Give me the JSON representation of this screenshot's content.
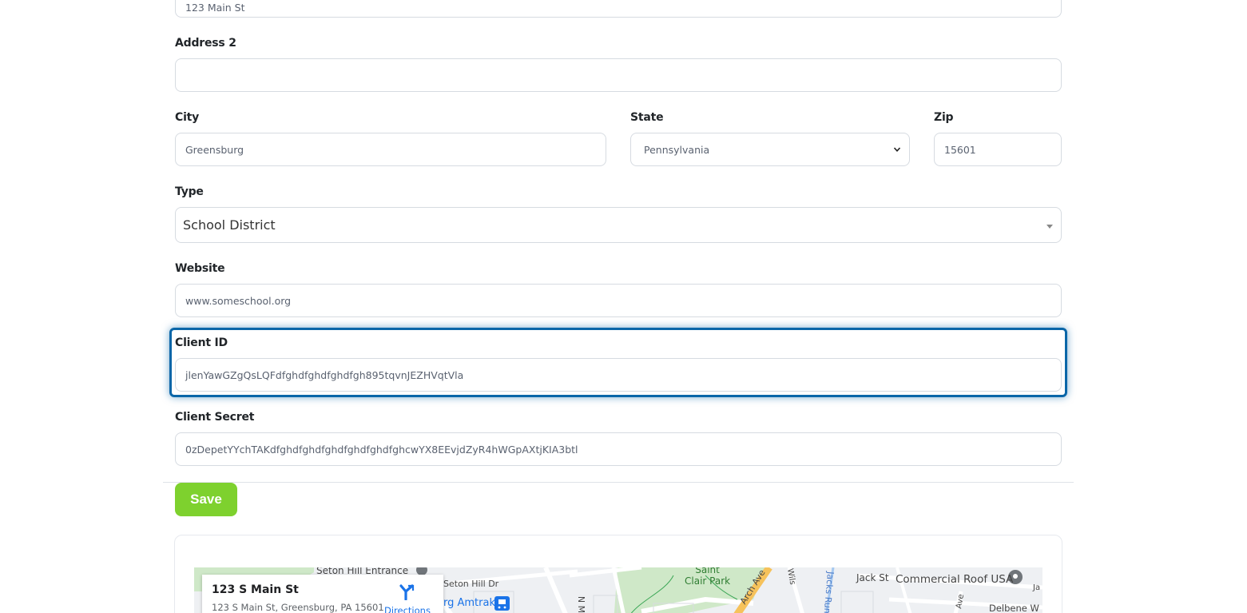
{
  "form": {
    "address1": {
      "value": "123 Main St"
    },
    "address2": {
      "label": "Address 2",
      "value": ""
    },
    "city": {
      "label": "City",
      "value": "Greensburg"
    },
    "state": {
      "label": "State",
      "value": "Pennsylvania"
    },
    "zip": {
      "label": "Zip",
      "value": "15601"
    },
    "type": {
      "label": "Type",
      "value": "School District"
    },
    "website": {
      "label": "Website",
      "value": "www.someschool.org"
    },
    "client_id": {
      "label": "Client ID",
      "value": "jlenYawGZgQsLQFdfghdfghdfghdfgh895tqvnJEZHVqtVla"
    },
    "client_secret": {
      "label": "Client Secret",
      "value": "0zDepetYYchTAKdfghdfghdfghdfghdfghdfghcwYX8EEvjdZyR4hWGpAXtjKIA3btl"
    },
    "save_label": "Save"
  },
  "map": {
    "info_title": "123 S Main St",
    "info_address": "123 S Main St, Greensburg, PA 15601",
    "directions_label": "Directions",
    "labels": {
      "seton_hill_entrance": "Seton Hill Entrance",
      "seton_hill_dr": "Seton Hill Dr",
      "amtrak": "rg Amtrak",
      "saint_clair_park": "Saint\nClair Park",
      "arch_ave": "Arch Ave",
      "wils": "Wils",
      "jacks_run": "Jacks Run",
      "jack_st": "Jack St",
      "commercial_roof": "Commercial Roof USA",
      "delbene": "Delbene W",
      "ave": "Ave",
      "ja": "Ja",
      "n_m": "N M"
    },
    "colors": {
      "park": "#cfe8c8",
      "road": "#ffffff",
      "arterial": "#f6c25b",
      "water": "#a5c8f0",
      "pin": "#70757a",
      "amtrak_icon": "#1a73e8"
    }
  },
  "colors": {
    "save_button": "#7ed12e",
    "focus_border": "#0a66a8"
  }
}
